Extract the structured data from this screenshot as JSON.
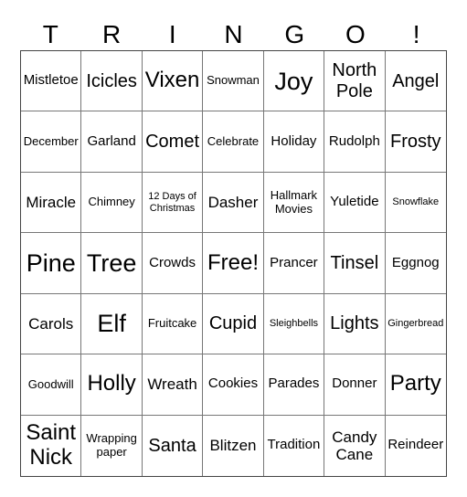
{
  "title_letters": [
    "T",
    "R",
    "I",
    "N",
    "G",
    "O",
    "!"
  ],
  "cells": [
    [
      "Mistletoe",
      "Icicles",
      "Vixen",
      "Snowman",
      "Joy",
      "North Pole",
      "Angel"
    ],
    [
      "December",
      "Garland",
      "Comet",
      "Celebrate",
      "Holiday",
      "Rudolph",
      "Frosty"
    ],
    [
      "Miracle",
      "Chimney",
      "12 Days of Christmas",
      "Dasher",
      "Hallmark Movies",
      "Yuletide",
      "Snowflake"
    ],
    [
      "Pine",
      "Tree",
      "Crowds",
      "Free!",
      "Prancer",
      "Tinsel",
      "Eggnog"
    ],
    [
      "Carols",
      "Elf",
      "Fruitcake",
      "Cupid",
      "Sleighbells",
      "Lights",
      "Gingerbread"
    ],
    [
      "Goodwill",
      "Holly",
      "Wreath",
      "Cookies",
      "Parades",
      "Donner",
      "Party"
    ],
    [
      "Saint Nick",
      "Wrapping paper",
      "Santa",
      "Blitzen",
      "Tradition",
      "Candy Cane",
      "Reindeer"
    ]
  ]
}
